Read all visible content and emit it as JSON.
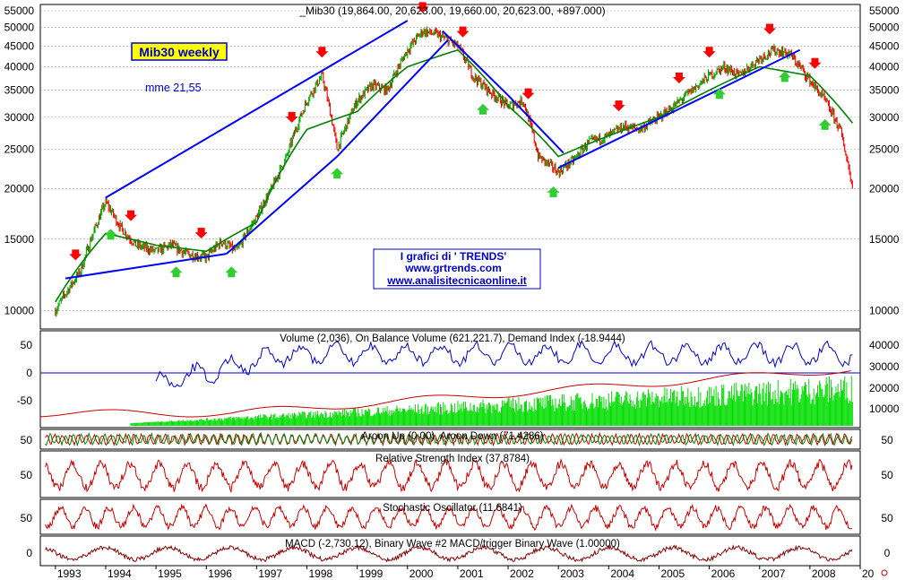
{
  "chart_data": {
    "type": "line",
    "title": "_Mib30 (19,864.00, 20,623.00, 19,660.00, 20,623.00, +897.000)",
    "legend_box": "Mib30 weekly",
    "mme_label": "mme 21,55",
    "source_box": {
      "line1": "I grafici di ' TRENDS'",
      "line2": "www.grtrends.com",
      "line3": "www.analisitecnicaonline.it"
    },
    "x_labels": [
      "1993",
      "1994",
      "1995",
      "1996",
      "1997",
      "1998",
      "1999",
      "2000",
      "2001",
      "2002",
      "2003",
      "2004",
      "2005",
      "2006",
      "2007",
      "2008",
      "20"
    ],
    "price_ticks": [
      "55000",
      "50000",
      "45000",
      "40000",
      "35000",
      "30000",
      "25000",
      "20000",
      "15000",
      "10000"
    ],
    "price_scale": "log",
    "price_ylim": [
      9000,
      57000
    ],
    "price_series": {
      "name": "Mib30",
      "x": [
        1993.0,
        1993.5,
        1994.0,
        1994.3,
        1994.6,
        1995.0,
        1995.3,
        1995.6,
        1996.0,
        1996.3,
        1996.6,
        1997.0,
        1997.3,
        1997.6,
        1998.0,
        1998.3,
        1998.6,
        1999.0,
        1999.3,
        1999.6,
        2000.0,
        2000.3,
        2000.6,
        2001.0,
        2001.3,
        2001.6,
        2002.0,
        2002.3,
        2002.6,
        2003.0,
        2003.3,
        2003.6,
        2004.0,
        2004.3,
        2004.6,
        2005.0,
        2005.3,
        2005.6,
        2006.0,
        2006.3,
        2006.6,
        2007.0,
        2007.3,
        2007.6,
        2008.0,
        2008.3,
        2008.6,
        2008.85
      ],
      "values": [
        10000,
        12500,
        18500,
        16000,
        14500,
        14000,
        14500,
        13800,
        13500,
        14800,
        14000,
        17000,
        20000,
        24000,
        33000,
        38000,
        25000,
        33000,
        36000,
        35000,
        44000,
        49000,
        48000,
        45000,
        38000,
        35000,
        32000,
        33000,
        24000,
        22000,
        23500,
        26000,
        27000,
        28500,
        28000,
        30000,
        32000,
        34500,
        38000,
        40000,
        38000,
        42000,
        44000,
        43000,
        37000,
        33000,
        28000,
        20000
      ]
    },
    "ema_series": {
      "name": "mme 21,55",
      "x": [
        1993.0,
        1994.0,
        1995.0,
        1996.0,
        1997.0,
        1998.0,
        1999.0,
        2000.0,
        2001.0,
        2002.0,
        2003.0,
        2004.0,
        2005.0,
        2006.0,
        2007.0,
        2008.0,
        2008.85
      ],
      "values": [
        10500,
        15500,
        14500,
        14000,
        16500,
        28000,
        31000,
        40000,
        44000,
        32000,
        24000,
        27000,
        30000,
        35000,
        40000,
        38000,
        29000
      ]
    },
    "up_arrows_x": [
      1994.1,
      1995.4,
      1996.5,
      1998.6,
      2001.5,
      2002.9,
      2006.2,
      2007.5,
      2008.3
    ],
    "down_arrows_x": [
      1993.4,
      1994.5,
      1995.9,
      1997.7,
      1998.3,
      2000.3,
      2001.1,
      2002.4,
      2004.2,
      2005.4,
      2006.0,
      2007.2,
      2008.1
    ],
    "trendlines": [
      {
        "x": [
          1994.0,
          2000.0
        ],
        "values": [
          19000,
          52000
        ]
      },
      {
        "x": [
          1998.6,
          2000.8
        ],
        "values": [
          24000,
          46500
        ]
      },
      {
        "x": [
          2000.7,
          2002.0
        ],
        "values": [
          49000,
          34000
        ]
      },
      {
        "x": [
          1993.2,
          1996.4
        ],
        "values": [
          12000,
          13800
        ]
      },
      {
        "x": [
          1996.4,
          1998.6
        ],
        "values": [
          13800,
          24000
        ]
      },
      {
        "x": [
          2002.0,
          2003.1
        ],
        "values": [
          34000,
          24500
        ]
      },
      {
        "x": [
          2003.0,
          2007.8
        ],
        "values": [
          22500,
          44000
        ]
      }
    ],
    "volume_panel": {
      "title": "Volume (2,036), On Balance Volume (621,221.7), Demand Index (-18.9444)",
      "left_ticks": [
        "50",
        "0",
        "-50"
      ],
      "right_ticks": [
        "40000",
        "30000",
        "20000",
        "10000"
      ]
    },
    "aroon_panel": {
      "title": "Aroon Up (0.00), Aroon Down (71.4286)",
      "left_tick": "50",
      "right_tick": "50"
    },
    "rsi_panel": {
      "title": "Relative Strength Index (37.8784)",
      "left_tick": "50",
      "right_tick": "50"
    },
    "stoch_panel": {
      "title": "Stochastic Oscillator (11.6841)",
      "left_tick": "50",
      "right_tick": "50"
    },
    "macd_panel": {
      "title": "MACD (-2,730.12), Binary Wave #2  MACD/trigger Binary Wave (1.00000)",
      "left_tick": "0",
      "right_tick": "0"
    },
    "colors": {
      "trend": "#0000ff",
      "ema": "#008000",
      "up_bar": "#00aa00",
      "down_bar": "#ff0000",
      "obv": "#0000cc",
      "demand": "#cc0000",
      "volume": "#00dd00"
    }
  }
}
